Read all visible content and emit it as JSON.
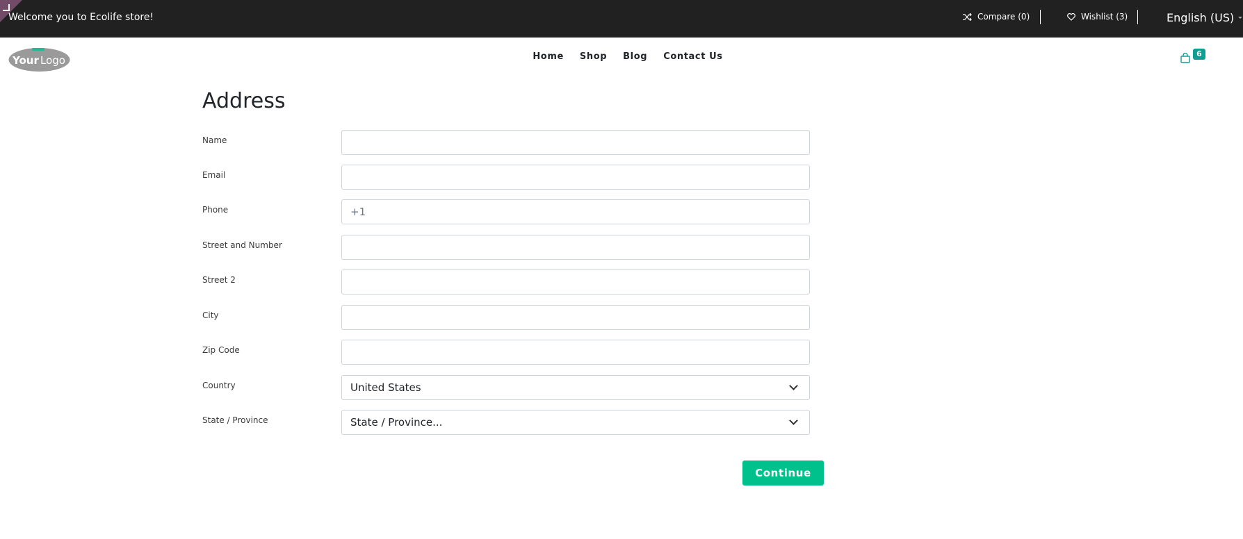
{
  "topbar": {
    "welcome": "Welcome you to Ecolife store!",
    "compare": "Compare (0)",
    "wishlist": "Wishlist (3)",
    "language": "English (US)"
  },
  "header": {
    "logo_text": "YourLogo",
    "nav": [
      "Home",
      "Shop",
      "Blog",
      "Contact Us"
    ],
    "cart_count": "6"
  },
  "form": {
    "title": "Address",
    "fields": {
      "name": {
        "label": "Name",
        "value": ""
      },
      "email": {
        "label": "Email",
        "value": ""
      },
      "phone": {
        "label": "Phone",
        "placeholder": "+1"
      },
      "street": {
        "label": "Street and Number",
        "value": ""
      },
      "street2": {
        "label": "Street 2",
        "value": ""
      },
      "city": {
        "label": "City",
        "value": ""
      },
      "zip": {
        "label": "Zip Code",
        "value": ""
      },
      "country": {
        "label": "Country",
        "selected": "United States"
      },
      "state": {
        "label": "State / Province",
        "selected": "State / Province..."
      }
    },
    "continue_label": "Continue"
  },
  "colors": {
    "topbar_bg": "#212121",
    "accent": "#00c18c",
    "cart_badge": "#0f9e93",
    "edit_corner": "#714b67"
  },
  "icons": [
    "shuffle-icon",
    "heart-icon",
    "shopping-bag-icon",
    "chevron-down-icon"
  ]
}
